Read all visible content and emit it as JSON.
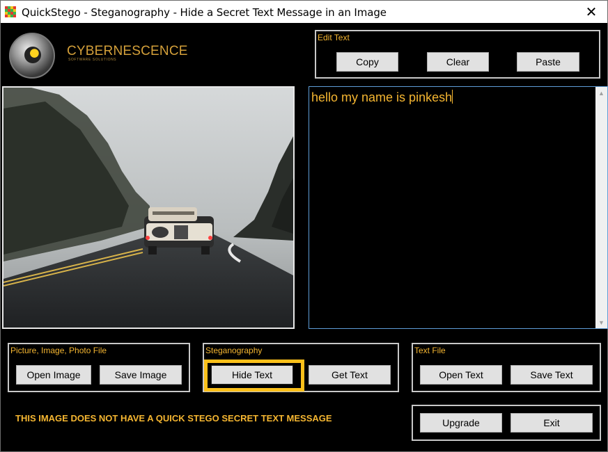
{
  "window": {
    "title": "QuickStego - Steganography - Hide a Secret Text Message in an Image",
    "close_icon": "close-icon"
  },
  "logo": {
    "name": "CYBERNESCENCE",
    "subtitle": "SOFTWARE SOLUTIONS"
  },
  "edit_text": {
    "label": "Edit Text",
    "copy": "Copy",
    "clear": "Clear",
    "paste": "Paste"
  },
  "message": {
    "text": "hello my name is pinkesh"
  },
  "picture_group": {
    "label": "Picture, Image, Photo File",
    "open": "Open Image",
    "save": "Save Image"
  },
  "stego_group": {
    "label": "Steganography",
    "hide": "Hide Text",
    "get": "Get Text"
  },
  "textfile_group": {
    "label": "Text File",
    "open": "Open Text",
    "save": "Save Text"
  },
  "footer": {
    "upgrade": "Upgrade",
    "exit": "Exit"
  },
  "status": "THIS IMAGE DOES NOT HAVE A QUICK STEGO SECRET TEXT MESSAGE",
  "colors": {
    "accent": "#f5b631",
    "focus_ring": "#fbc01a",
    "text_border": "#5f9ed8"
  }
}
